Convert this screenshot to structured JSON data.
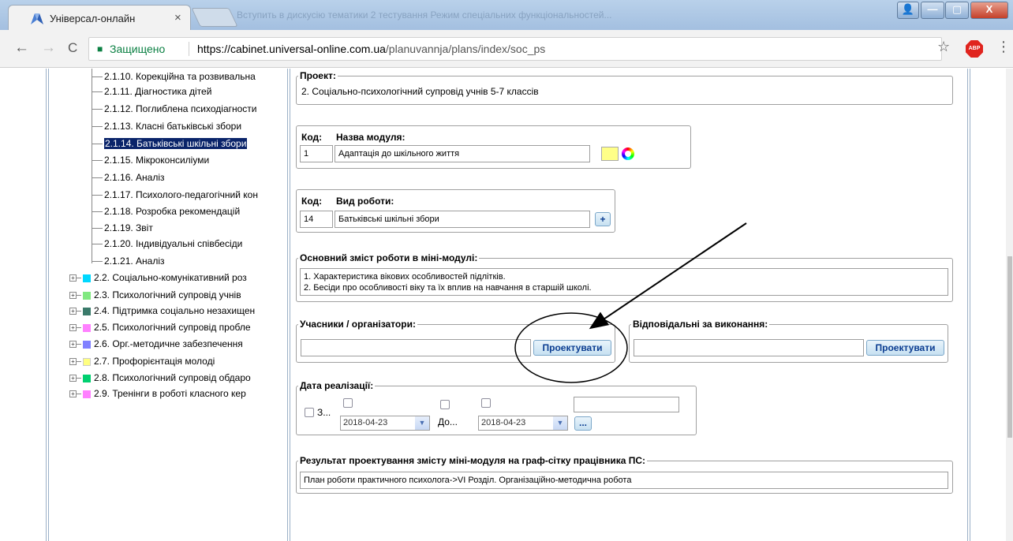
{
  "browser": {
    "tab_title": "Універсал-онлайн",
    "tab_close": "×",
    "blurred_tab_text": "Вступить в дискусію тематики 2 тестування Режим спеціальних функціональностей...",
    "window_buttons": [
      "min",
      "max",
      "close"
    ],
    "window_button_glyphs": {
      "user": "👤",
      "min": "—",
      "max": "▢",
      "close": "X"
    },
    "nav_glyphs": {
      "back": "←",
      "forward": "→",
      "reload": "C"
    },
    "secure_label": "Защищено",
    "url_host": "https://cabinet.universal-online.com.ua",
    "url_path": "/planuvannja/plans/index/soc_ps",
    "abp_label": "ABP",
    "icons": [
      "back-icon",
      "forward-icon",
      "reload-icon",
      "lock-icon",
      "star-icon",
      "menu-icon"
    ]
  },
  "tree": {
    "items": [
      {
        "label": "2.1.10. Корекційна та розвивальна",
        "selected": false
      },
      {
        "label": "2.1.11. Діагностика дітей",
        "selected": false
      },
      {
        "label": "2.1.12. Поглиблена психодіагности",
        "selected": false
      },
      {
        "label": "2.1.13. Класні батьківські збори",
        "selected": false
      },
      {
        "label": "2.1.14. Батьківські шкільні збори",
        "selected": true
      },
      {
        "label": "2.1.15. Мікроконсиліуми",
        "selected": false
      },
      {
        "label": "2.1.16. Аналіз",
        "selected": false
      },
      {
        "label": "2.1.17. Психолого-педагогічний кон",
        "selected": false
      },
      {
        "label": "2.1.18. Розробка рекомендацій",
        "selected": false
      },
      {
        "label": "2.1.19. Звіт",
        "selected": false
      },
      {
        "label": "2.1.20. Індивідуальні співбесіди",
        "selected": false
      },
      {
        "label": "2.1.21. Аналіз",
        "selected": false
      }
    ],
    "groups": [
      {
        "label": "2.2. Соціально-комунікативний роз",
        "color": "#00d8ff"
      },
      {
        "label": "2.3. Психологічний супровід учнів",
        "color": "#80e880"
      },
      {
        "label": "2.4. Підтримка соціально незахищен",
        "color": "#3a7a6a"
      },
      {
        "label": "2.5. Психологічний супровід пробле",
        "color": "#ff80ff"
      },
      {
        "label": "2.6. Орг.-методичне забезпечення",
        "color": "#8080ff"
      },
      {
        "label": "2.7. Профорієнтація молоді",
        "color": "#ffff80"
      },
      {
        "label": "2.8. Психологічний супровід обдаро",
        "color": "#00d070"
      },
      {
        "label": "2.9. Тренінги в роботі класного кер",
        "color": "#ff80ff"
      }
    ]
  },
  "form": {
    "project_legend": "Проект:",
    "project_value": "2. Соціально-психологічний супровід учнів 5-7 классів",
    "module_code_label": "Код:",
    "module_name_label": "Назва модуля:",
    "module_code": "1",
    "module_name": "Адаптація до шкільного життя",
    "module_color": "#ffff88",
    "work_code_label": "Код:",
    "work_type_label": "Вид роботи:",
    "work_code": "14",
    "work_type": "Батьківські шкільні збори",
    "add_glyph": "+",
    "content_legend": "Основний зміст роботи в міні-модулі:",
    "content_lines": [
      "1.  Характеристика вікових особливостей підлітків.",
      "2. Бесіди про особливості віку та їх вплив на навчання в старшій школі."
    ],
    "participants_legend": "Учасники / організатори:",
    "participants_value": "",
    "design_button": "Проектувати",
    "responsible_legend": "Відповідальні за виконання:",
    "responsible_value": "",
    "date_legend": "Дата реалізації:",
    "date_from_label": "З...",
    "date_to_label": "До...",
    "date_from": "2018-04-23",
    "date_to": "2018-04-23",
    "dropdown_glyph": "▼",
    "dots_button": "...",
    "date_extra_value": "",
    "result_legend": "Результат проектування змісту міні-модуля на граф-сітку працівника ПС:",
    "result_value": "План роботи практичного психолога->VI Розділ. Організаційно-методична робота"
  }
}
